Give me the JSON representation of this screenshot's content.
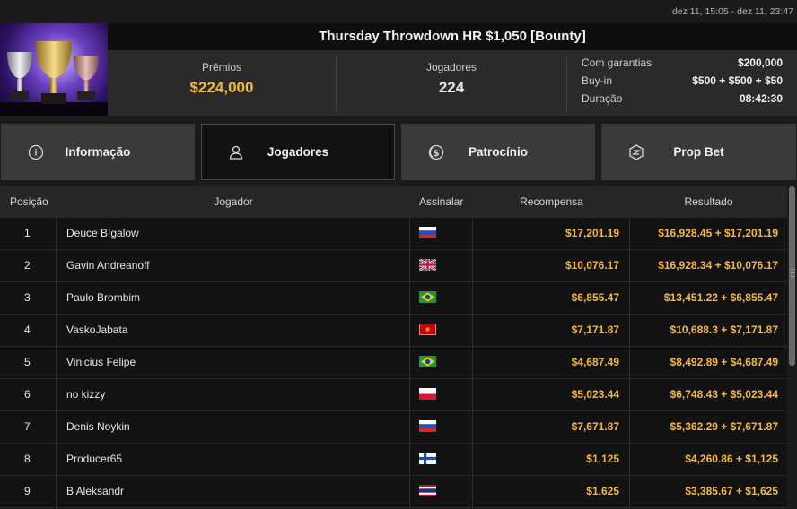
{
  "date_range": "dez 11, 15:05 - dez 11, 23:47",
  "tournament": {
    "title": "Thursday Throwdown HR $1,050 [Bounty]",
    "prizes_label": "Prêmios",
    "prizes_value": "$224,000",
    "players_label": "Jogadores",
    "players_value": "224",
    "details": [
      {
        "label": "Com garantias",
        "value": "$200,000"
      },
      {
        "label": "Buy-in",
        "value": "$500 + $500 + $50"
      },
      {
        "label": "Duração",
        "value": "08:42:30"
      }
    ]
  },
  "tabs": [
    {
      "label": "Informação",
      "icon": "info-icon",
      "active": false
    },
    {
      "label": "Jogadores",
      "icon": "user-icon",
      "active": true
    },
    {
      "label": "Patrocínio",
      "icon": "dollar-coin-icon",
      "active": false
    },
    {
      "label": "Prop Bet",
      "icon": "shield-bet-icon",
      "active": false
    }
  ],
  "table": {
    "headers": [
      "Posição",
      "Jogador",
      "Assinalar",
      "Recompensa",
      "Resultado"
    ],
    "rows": [
      {
        "pos": "1",
        "player": "Deuce B!galow",
        "flag": "ru",
        "reward": "$17,201.19",
        "result": "$16,928.45 + $17,201.19"
      },
      {
        "pos": "2",
        "player": "Gavin Andreanoff",
        "flag": "gb",
        "reward": "$10,076.17",
        "result": "$16,928.34 + $10,076.17"
      },
      {
        "pos": "3",
        "player": "Paulo Brombim",
        "flag": "br",
        "reward": "$6,855.47",
        "result": "$13,451.22 + $6,855.47"
      },
      {
        "pos": "4",
        "player": "VaskoJabata",
        "flag": "me",
        "reward": "$7,171.87",
        "result": "$10,688.3 + $7,171.87"
      },
      {
        "pos": "5",
        "player": "Vinicius Felipe",
        "flag": "br",
        "reward": "$4,687.49",
        "result": "$8,492.89 + $4,687.49"
      },
      {
        "pos": "6",
        "player": "no kizzy",
        "flag": "pl",
        "reward": "$5,023.44",
        "result": "$6,748.43 + $5,023.44"
      },
      {
        "pos": "7",
        "player": "Denis Noykin",
        "flag": "ru",
        "reward": "$7,671.87",
        "result": "$5,362.29 + $7,671.87"
      },
      {
        "pos": "8",
        "player": "Producer65",
        "flag": "fi",
        "reward": "$1,125",
        "result": "$4,260.86 + $1,125"
      },
      {
        "pos": "9",
        "player": "B Aleksandr",
        "flag": "th",
        "reward": "$1,625",
        "result": "$3,385.67 + $1,625"
      }
    ]
  },
  "colors": {
    "accent": "#f3b844",
    "tab_bg": "#3a3a3a",
    "active_tab_bg": "#121212"
  }
}
